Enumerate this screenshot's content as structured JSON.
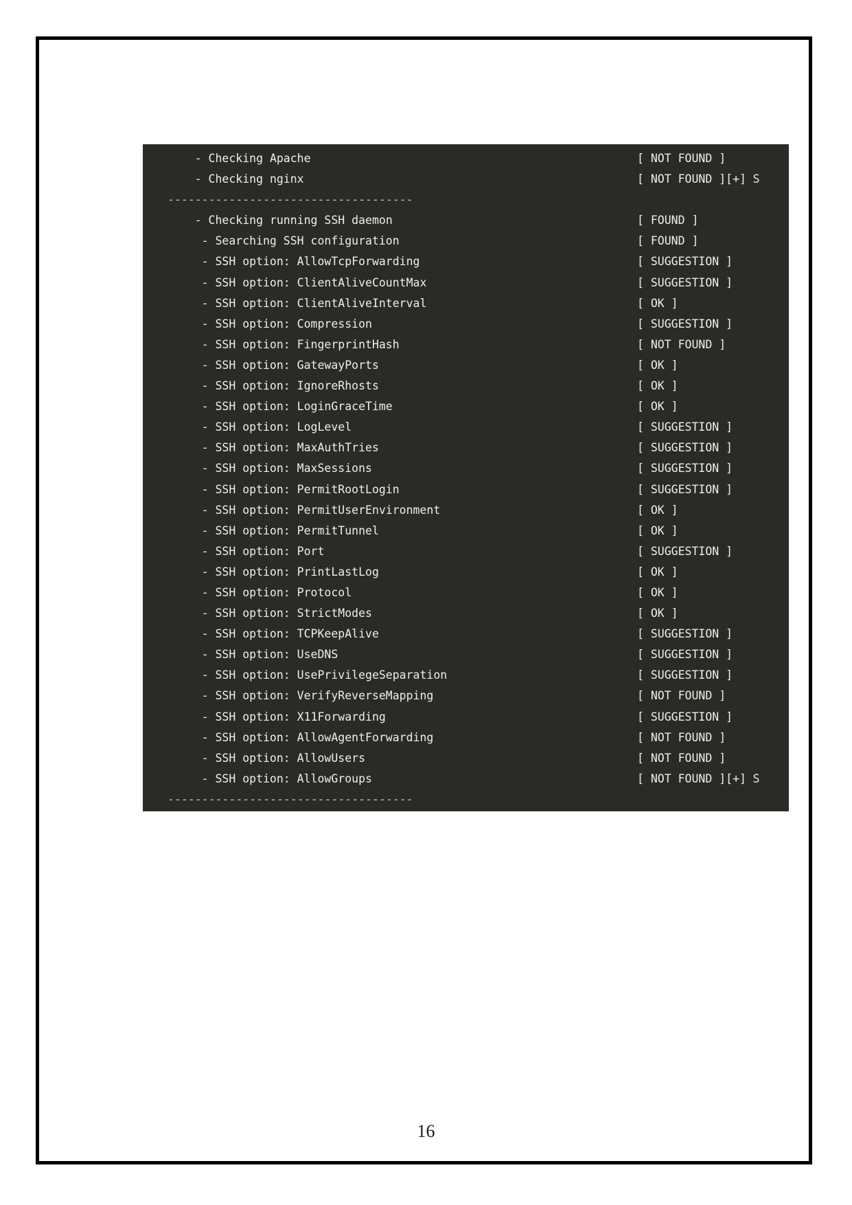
{
  "page": {
    "number": "16",
    "background_color": "#ffffff",
    "frame_color": "#000000"
  },
  "terminal": {
    "background_color": "#2a2b26",
    "text_color": "#f2efe4",
    "bracket_color": "#cfe8d8",
    "rule_color": "#c9c6b8",
    "divider_top": "------------------------------------",
    "divider_bottom": "------------------------------------",
    "lines": [
      {
        "indent": 4,
        "label": "- Checking Apache",
        "status": "[ NOT FOUND ]",
        "tail": ""
      },
      {
        "indent": 4,
        "label": "- Checking nginx",
        "status": "[ NOT FOUND ][+] ",
        "tail": "S"
      },
      {
        "indent": 0,
        "label": "------------------------------------",
        "status": "",
        "tail": "",
        "rule": true
      },
      {
        "indent": 4,
        "label": "- Checking running SSH daemon",
        "status": "[ FOUND ]",
        "tail": ""
      },
      {
        "indent": 5,
        "label": "- Searching SSH configuration",
        "status": "[ FOUND ]",
        "tail": ""
      },
      {
        "indent": 5,
        "label": "- SSH option: AllowTcpForwarding",
        "status": "[ SUGGESTION ]",
        "tail": ""
      },
      {
        "indent": 5,
        "label": "- SSH option: ClientAliveCountMax",
        "status": "[ SUGGESTION ]",
        "tail": ""
      },
      {
        "indent": 5,
        "label": "- SSH option: ClientAliveInterval",
        "status": "[ OK ]",
        "tail": ""
      },
      {
        "indent": 5,
        "label": "- SSH option: Compression",
        "status": "[ SUGGESTION ]",
        "tail": ""
      },
      {
        "indent": 5,
        "label": "- SSH option: FingerprintHash",
        "status": "[ NOT FOUND ]",
        "tail": ""
      },
      {
        "indent": 5,
        "label": "- SSH option: GatewayPorts",
        "status": "[ OK ]",
        "tail": ""
      },
      {
        "indent": 5,
        "label": "- SSH option: IgnoreRhosts",
        "status": "[ OK ]",
        "tail": ""
      },
      {
        "indent": 5,
        "label": "- SSH option: LoginGraceTime",
        "status": "[ OK ]",
        "tail": ""
      },
      {
        "indent": 5,
        "label": "- SSH option: LogLevel",
        "status": "[ SUGGESTION ]",
        "tail": ""
      },
      {
        "indent": 5,
        "label": "- SSH option: MaxAuthTries",
        "status": "[ SUGGESTION ]",
        "tail": ""
      },
      {
        "indent": 5,
        "label": "- SSH option: MaxSessions",
        "status": "[ SUGGESTION ]",
        "tail": ""
      },
      {
        "indent": 5,
        "label": "- SSH option: PermitRootLogin",
        "status": "[ SUGGESTION ]",
        "tail": ""
      },
      {
        "indent": 5,
        "label": "- SSH option: PermitUserEnvironment",
        "status": "[ OK ]",
        "tail": ""
      },
      {
        "indent": 5,
        "label": "- SSH option: PermitTunnel",
        "status": "[ OK ]",
        "tail": ""
      },
      {
        "indent": 5,
        "label": "- SSH option: Port",
        "status": "[ SUGGESTION ]",
        "tail": ""
      },
      {
        "indent": 5,
        "label": "- SSH option: PrintLastLog",
        "status": "[ OK ]",
        "tail": ""
      },
      {
        "indent": 5,
        "label": "- SSH option: Protocol",
        "status": "[ OK ]",
        "tail": ""
      },
      {
        "indent": 5,
        "label": "- SSH option: StrictModes",
        "status": "[ OK ]",
        "tail": ""
      },
      {
        "indent": 5,
        "label": "- SSH option: TCPKeepAlive",
        "status": "[ SUGGESTION ]",
        "tail": ""
      },
      {
        "indent": 5,
        "label": "- SSH option: UseDNS",
        "status": "[ SUGGESTION ]",
        "tail": ""
      },
      {
        "indent": 5,
        "label": "- SSH option: UsePrivilegeSeparation",
        "status": "[ SUGGESTION ]",
        "tail": ""
      },
      {
        "indent": 5,
        "label": "- SSH option: VerifyReverseMapping",
        "status": "[ NOT FOUND ]",
        "tail": ""
      },
      {
        "indent": 5,
        "label": "- SSH option: X11Forwarding",
        "status": "[ SUGGESTION ]",
        "tail": ""
      },
      {
        "indent": 5,
        "label": "- SSH option: AllowAgentForwarding",
        "status": "[ NOT FOUND ]",
        "tail": ""
      },
      {
        "indent": 5,
        "label": "- SSH option: AllowUsers",
        "status": "[ NOT FOUND ]",
        "tail": ""
      },
      {
        "indent": 5,
        "label": "- SSH option: AllowGroups",
        "status": "[ NOT FOUND ][+] ",
        "tail": "S"
      },
      {
        "indent": 0,
        "label": "------------------------------------",
        "status": "",
        "tail": "",
        "rule": true
      }
    ]
  }
}
